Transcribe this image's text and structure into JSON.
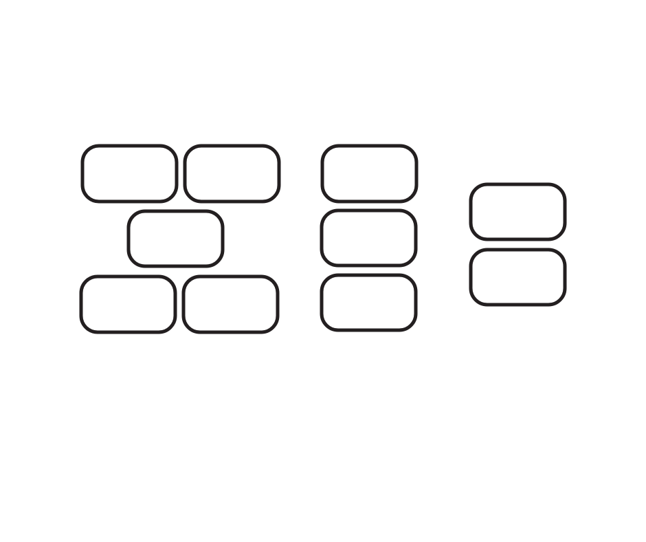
{
  "colors": {
    "background": "#ffffff",
    "outline": "#231f20"
  },
  "groups": [
    {
      "name": "group-five",
      "count": 5
    },
    {
      "name": "group-three",
      "count": 3
    },
    {
      "name": "group-two",
      "count": 2
    }
  ]
}
